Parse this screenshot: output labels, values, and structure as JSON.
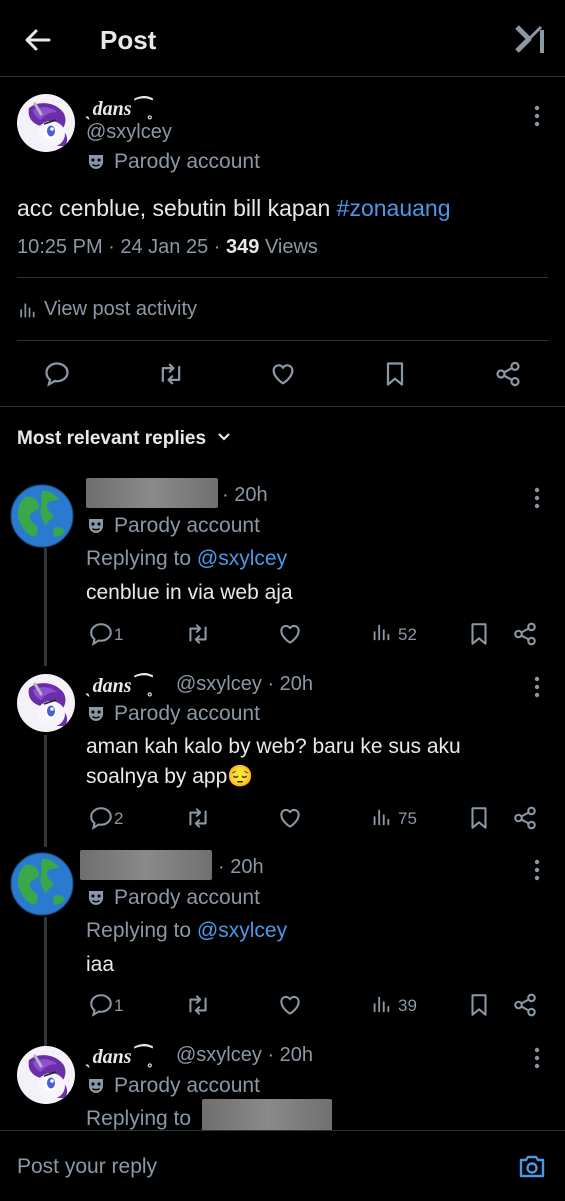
{
  "header": {
    "title": "Post"
  },
  "post": {
    "name": "dans",
    "handle": "@sxylcey",
    "badge": "Parody account",
    "text_plain": "acc cenblue, sebutin bill kapan ",
    "hashtag": "#zonauang",
    "time": "10:25 PM · 24 Jan 25 · ",
    "views_count": "349",
    "views_label": " Views",
    "activity": "View post activity"
  },
  "replies_sort": "Most relevant replies",
  "replies": [
    {
      "time": "· 20h",
      "badge": "Parody account",
      "replying_label": "Replying to ",
      "replying_handle": "@sxylcey",
      "text": "cenblue in via web aja",
      "reply_count": "1",
      "view_count": "52"
    },
    {
      "name": "dans",
      "handle": "@sxylcey",
      "time": "· 20h",
      "badge": "Parody account",
      "text_line1": "aman kah kalo by web? baru ke sus aku",
      "text_line2": "soalnya by app😔",
      "reply_count": "2",
      "view_count": "75"
    },
    {
      "time": "· 20h",
      "badge": "Parody account",
      "replying_label": "Replying to ",
      "replying_handle": "@sxylcey",
      "text": "iaa",
      "reply_count": "1",
      "view_count": "39"
    },
    {
      "name": "dans",
      "handle": "@sxylcey",
      "time": "· 20h",
      "badge": "Parody account",
      "replying_label": "Replying to"
    }
  ],
  "composer": {
    "placeholder": "Post your reply"
  },
  "colors": {
    "background": "#000000",
    "text": "#e7e9ea",
    "muted": "#8b98a5",
    "link": "#4a99e9",
    "divider": "#2f3336"
  }
}
